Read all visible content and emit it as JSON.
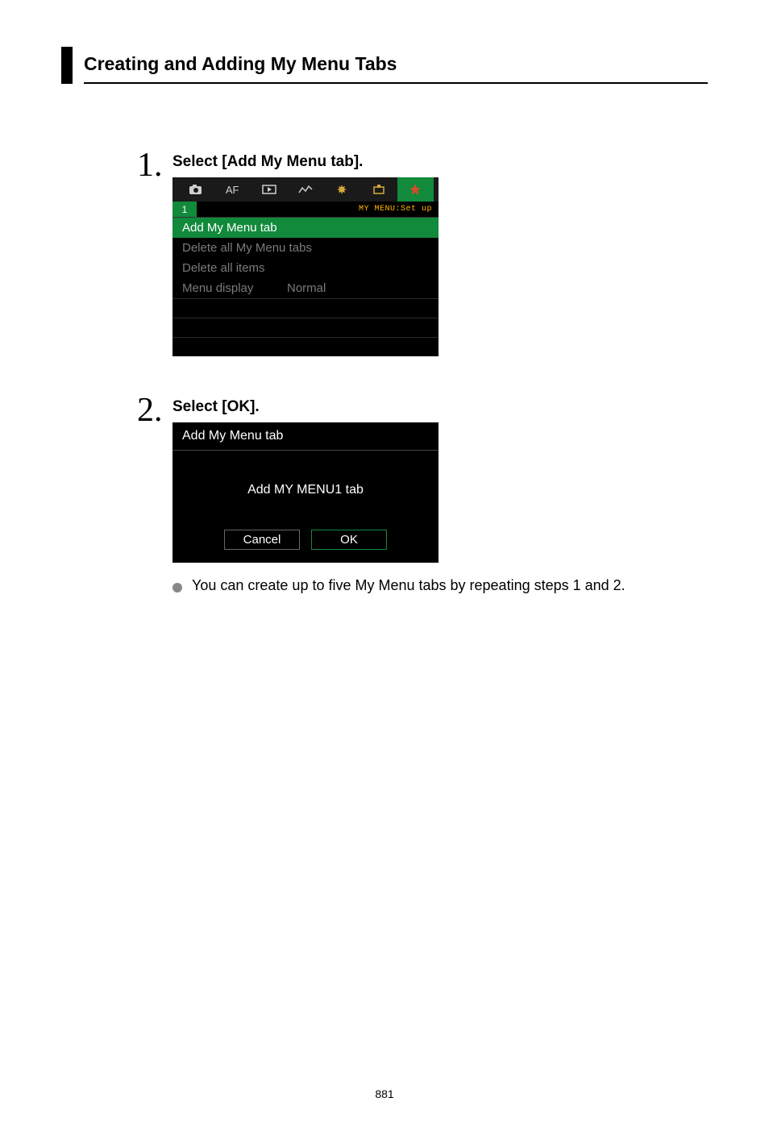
{
  "page": {
    "title": "Creating and Adding My Menu Tabs",
    "number": "881"
  },
  "steps": [
    {
      "num": "1.",
      "title": "Select [Add My Menu tab].",
      "screen": {
        "tabs_af": "AF",
        "sub_left": "1",
        "sub_right": "MY MENU:Set up",
        "rows": [
          {
            "label": "Add My Menu tab",
            "value": "",
            "sel": true
          },
          {
            "label": "Delete all My Menu tabs",
            "value": "",
            "sel": false,
            "dim": true
          },
          {
            "label": "Delete all items",
            "value": "",
            "sel": false,
            "dim": true
          },
          {
            "label": "Menu display",
            "value": "Normal",
            "sel": false,
            "dim": true
          }
        ]
      }
    },
    {
      "num": "2.",
      "title": "Select [OK].",
      "dialog": {
        "header": "Add My Menu tab",
        "message": "Add MY MENU1 tab",
        "cancel": "Cancel",
        "ok": "OK"
      },
      "note": "You can create up to five My Menu tabs by repeating steps 1 and 2."
    }
  ]
}
